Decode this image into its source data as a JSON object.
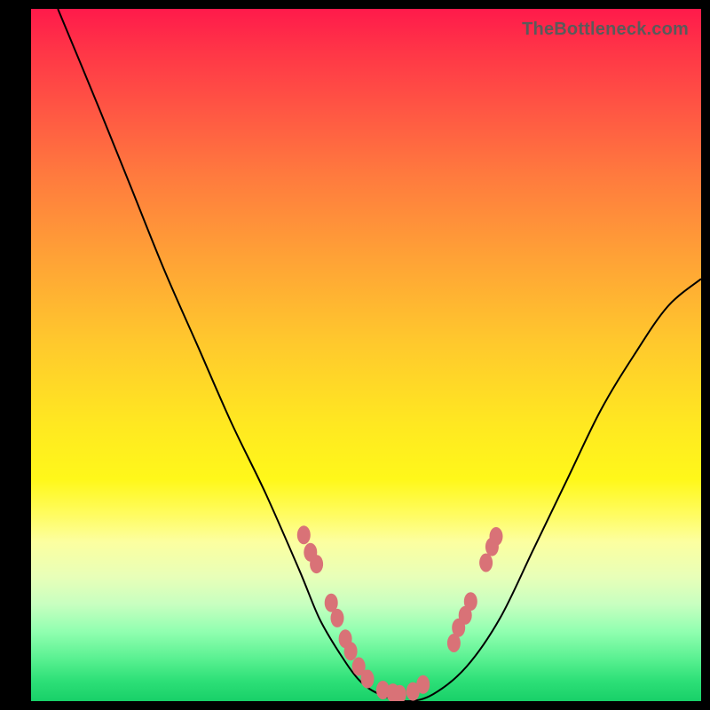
{
  "watermark": "TheBottleneck.com",
  "chart_data": {
    "type": "line",
    "title": "",
    "xlabel": "",
    "ylabel": "",
    "xlim": [
      0,
      100
    ],
    "ylim": [
      0,
      100
    ],
    "grid": false,
    "legend": false,
    "series": [
      {
        "name": "curve",
        "x": [
          4,
          10,
          15,
          20,
          25,
          30,
          35,
          40,
          43,
          46,
          49,
          52,
          56,
          60,
          65,
          70,
          75,
          80,
          85,
          90,
          95,
          100
        ],
        "y": [
          100,
          86,
          74,
          62,
          51,
          40,
          30,
          19,
          12,
          7,
          3,
          1,
          0,
          1,
          5,
          12,
          22,
          32,
          42,
          50,
          57,
          61
        ]
      }
    ],
    "markers": [
      {
        "x": 40.7,
        "y": 24.0
      },
      {
        "x": 41.7,
        "y": 21.5
      },
      {
        "x": 42.6,
        "y": 19.8
      },
      {
        "x": 44.8,
        "y": 14.2
      },
      {
        "x": 45.7,
        "y": 12.0
      },
      {
        "x": 46.9,
        "y": 9.0
      },
      {
        "x": 47.7,
        "y": 7.2
      },
      {
        "x": 48.9,
        "y": 5.0
      },
      {
        "x": 50.2,
        "y": 3.2
      },
      {
        "x": 52.5,
        "y": 1.6
      },
      {
        "x": 54.0,
        "y": 1.2
      },
      {
        "x": 55.0,
        "y": 1.0
      },
      {
        "x": 57.0,
        "y": 1.4
      },
      {
        "x": 58.5,
        "y": 2.4
      },
      {
        "x": 63.1,
        "y": 8.4
      },
      {
        "x": 63.8,
        "y": 10.6
      },
      {
        "x": 64.8,
        "y": 12.4
      },
      {
        "x": 65.6,
        "y": 14.4
      },
      {
        "x": 67.9,
        "y": 20.0
      },
      {
        "x": 68.8,
        "y": 22.3
      },
      {
        "x": 69.4,
        "y": 23.8
      }
    ]
  }
}
